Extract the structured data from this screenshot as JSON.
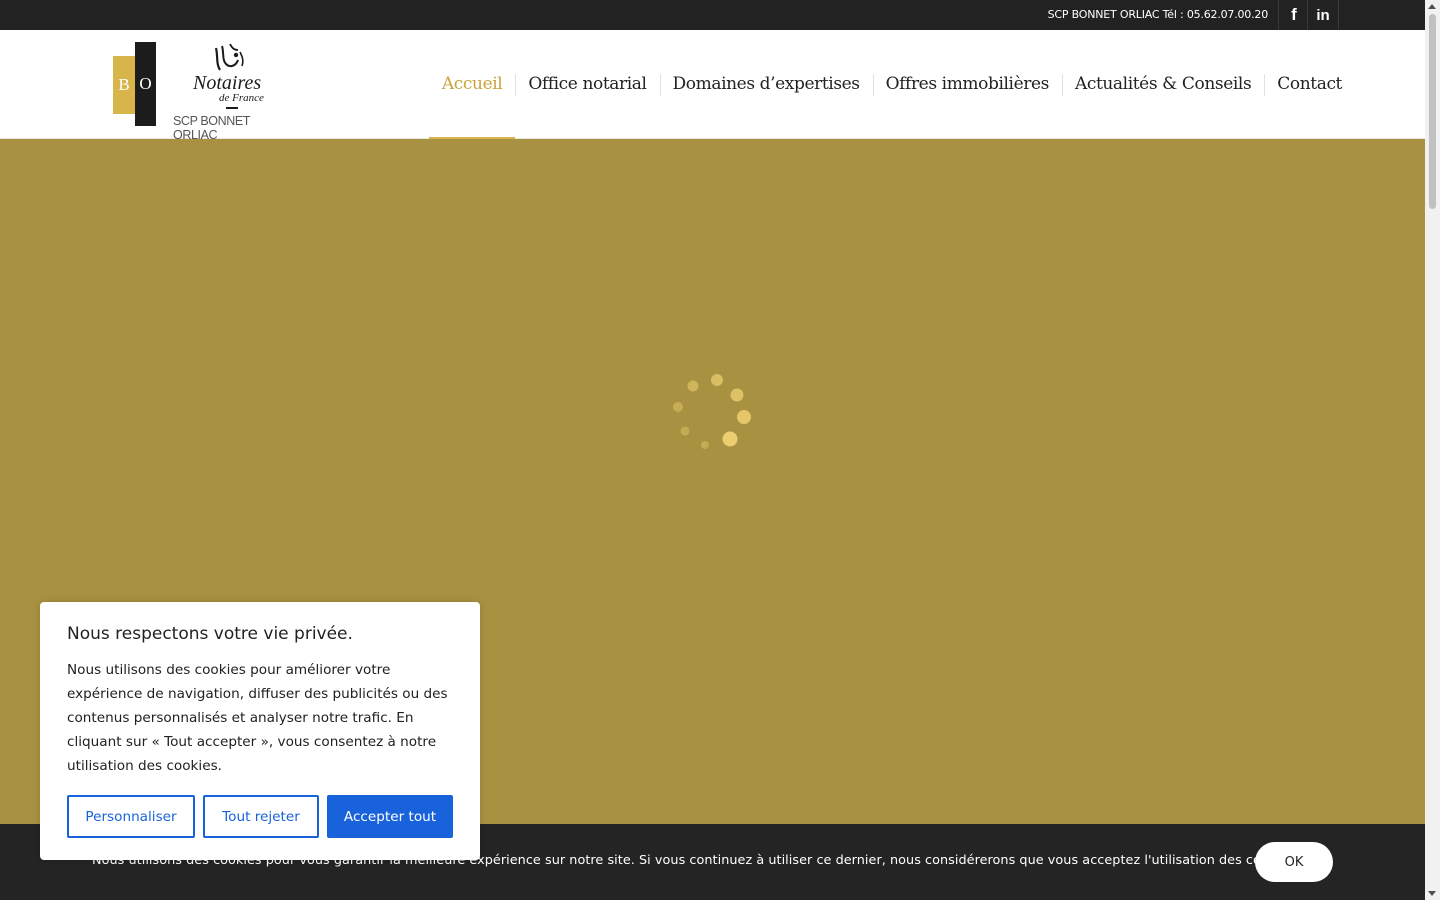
{
  "topbar": {
    "phone_text": "SCP BONNET ORLIAC Tél : 05.62.07.00.20",
    "facebook_glyph": "f",
    "linkedin_glyph": "in"
  },
  "logo": {
    "letter_b": "B",
    "letter_o": "O",
    "notaires": "Notaires",
    "de_france": "de France",
    "firm": "SCP BONNET ORLIAC"
  },
  "nav": {
    "items": [
      {
        "label": "Accueil",
        "active": true
      },
      {
        "label": "Office notarial"
      },
      {
        "label": "Domaines d’expertises"
      },
      {
        "label": "Offres immobilières"
      },
      {
        "label": "Actualités & Conseils"
      },
      {
        "label": "Contact"
      }
    ]
  },
  "colors": {
    "hero_bg": "#a99142",
    "accent_gold": "#d8b54a",
    "button_blue": "#1863dc",
    "dark": "#242424"
  },
  "cookie_modal": {
    "title": "Nous respectons votre vie privée.",
    "text": "Nous utilisons des cookies pour améliorer votre expérience de navigation, diffuser des publicités ou des contenus personnalisés et analyser notre trafic. En cliquant sur « Tout accepter », vous consentez à notre utilisation des cookies.",
    "customize_label": "Personnaliser",
    "reject_label": "Tout rejeter",
    "accept_label": "Accepter tout"
  },
  "cookie_bar": {
    "message": "Nous utilisons des cookies pour vous garantir la meilleure expérience sur notre site. Si vous continuez à utiliser ce dernier, nous considérerons que vous acceptez l'utilisation des cookies.",
    "ok_label": "OK"
  },
  "icons": {
    "spinner": "loading-spinner-icon",
    "facebook": "facebook-icon",
    "linkedin": "linkedin-icon"
  }
}
